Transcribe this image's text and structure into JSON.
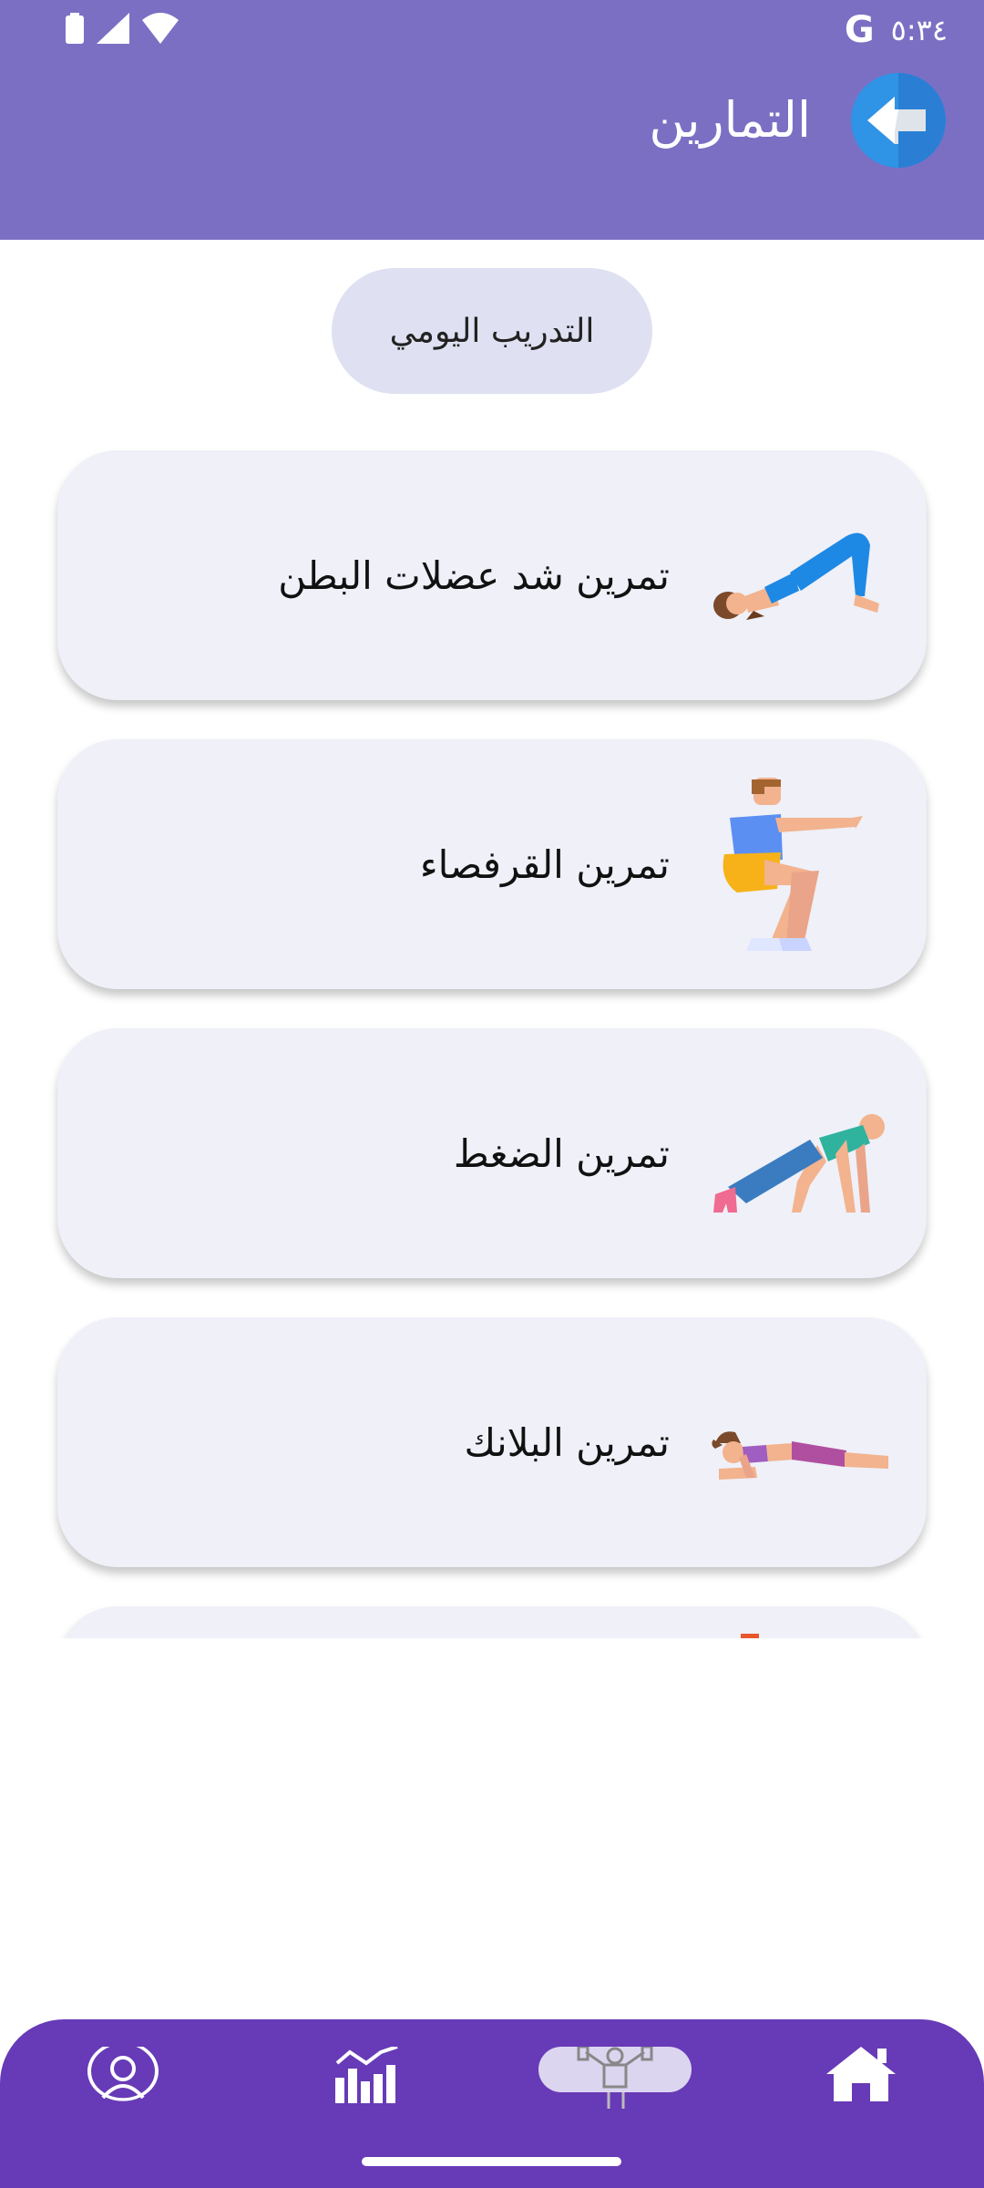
{
  "status_bar": {
    "time": "٥:٣٤",
    "google_letter": "G"
  },
  "header": {
    "title": "التمارين"
  },
  "daily_training_pill": {
    "label": "التدريب اليومي"
  },
  "exercises": [
    {
      "label": "تمرين شد عضلات البطن",
      "icon": "glute-bridge-figure-icon"
    },
    {
      "label": "تمرين القرفصاء",
      "icon": "squat-figure-icon"
    },
    {
      "label": "تمرين الضغط",
      "icon": "pushup-figure-icon"
    },
    {
      "label": "تمرين البلانك",
      "icon": "plank-figure-icon"
    }
  ],
  "bottom_nav": {
    "items": [
      {
        "icon": "profile-icon"
      },
      {
        "icon": "stats-chart-icon"
      },
      {
        "icon": "workout-icon",
        "active": true
      },
      {
        "icon": "home-icon"
      }
    ]
  },
  "colors": {
    "header": "#7b6fc4",
    "bottom_nav": "#673ab7",
    "card": "#eff0f8",
    "pill": "#dfe0f1",
    "back_button": "#2f93e6"
  }
}
